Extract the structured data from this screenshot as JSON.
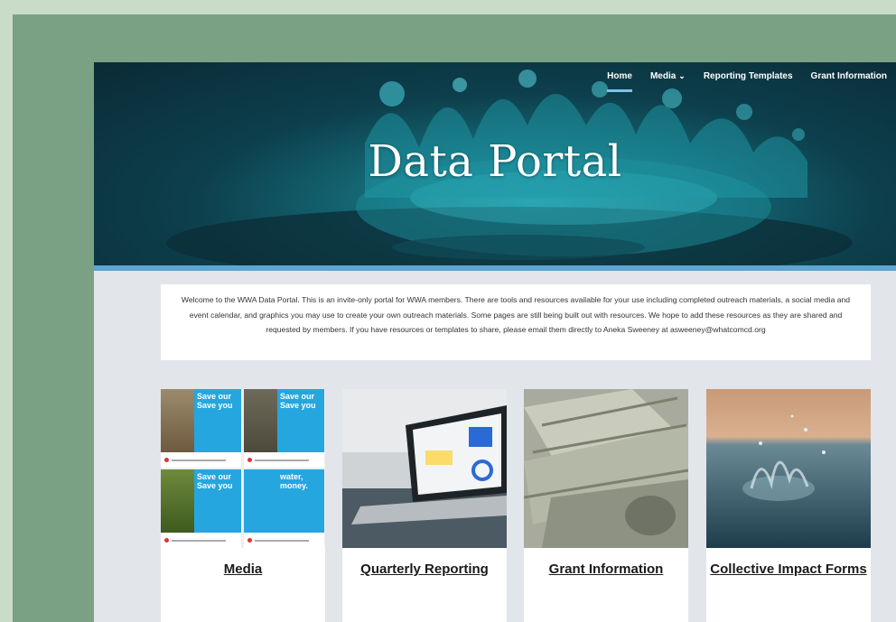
{
  "nav": {
    "items": [
      {
        "label": "Home",
        "active": true
      },
      {
        "label": "Media",
        "dropdown": true
      },
      {
        "label": "Reporting Templates"
      },
      {
        "label": "Grant Information"
      }
    ]
  },
  "hero": {
    "title": "Data Portal"
  },
  "intro": {
    "text": "Welcome to the WWA Data Portal.  This is an invite-only portal for WWA members. There are tools and resources available for your use including completed outreach materials, a social media and event calendar, and graphics you may use to create your own outreach materials.  Some pages are still being built out with resources.  We hope to add these resources as they are shared and requested by members. If you have resources or templates to share, please email them directly to Aneka Sweeney at asweeney@whatcomcd.org"
  },
  "cards": [
    {
      "label": "Media"
    },
    {
      "label": "Quarterly Reporting"
    },
    {
      "label": "Grant Information"
    },
    {
      "label": "Collective Impact Forms"
    }
  ],
  "media_tiles": [
    "Save our Save you",
    "Save our Save you",
    "Save our Save you",
    "water, money."
  ],
  "colors": {
    "accent": "#5ea5d0",
    "nav_active": "#7fc2e8",
    "panel_green": "#7ba184",
    "tile_blue": "#25a6de"
  },
  "icons": {
    "dropdown": "chevron-down-icon"
  }
}
